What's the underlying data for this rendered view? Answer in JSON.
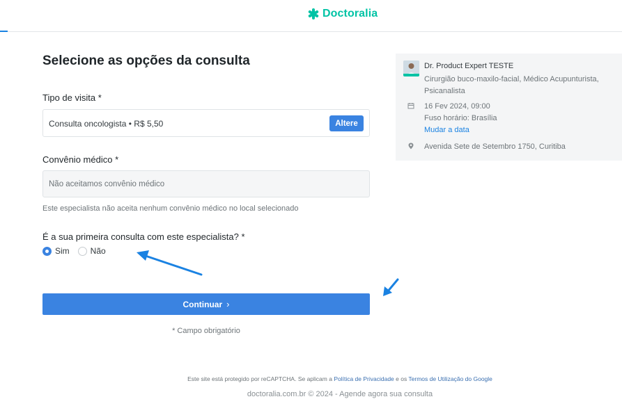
{
  "header": {
    "brand": "Doctoralia",
    "brand_color": "#00c3a5"
  },
  "form": {
    "title": "Selecione as opções da consulta",
    "visit_type": {
      "label": "Tipo de visita",
      "required_mark": "*",
      "value": "Consulta oncologista • R$ 5,50",
      "change_button": "Altere"
    },
    "insurance": {
      "label": "Convênio médico",
      "required_mark": "*",
      "value": "Não aceitamos convênio médico",
      "help": "Este especialista não aceita nenhum convênio médico no local selecionado"
    },
    "first_visit": {
      "question": "É a sua primeira consulta com este especialista?",
      "required_mark": "*",
      "options": [
        {
          "label": "Sim",
          "selected": true
        },
        {
          "label": "Não",
          "selected": false
        }
      ]
    },
    "continue_button": "Continuar",
    "continue_icon": "chevron-right-icon",
    "required_note": "* Campo obrigatório"
  },
  "summary": {
    "doctor_name": "Dr. Product Expert TESTE",
    "specialties": "Cirurgião buco-maxilo-facial, Médico Acupunturista, Psicanalista",
    "date": "16 Fev 2024, 09:00",
    "timezone": "Fuso horário: Brasília",
    "change_date": "Mudar a data",
    "address": "Avenida Sete de Setembro 1750, Curitiba"
  },
  "footer": {
    "recaptcha_prefix": "Este site está protegido por reCAPTCHA. Se aplicam a ",
    "privacy_link": "Política de Privacidade",
    "recaptcha_middle": " e os ",
    "terms_link": "Termos de Utilização do Google",
    "copyright": "doctoralia.com.br © 2024 - Agende agora sua consulta"
  },
  "colors": {
    "primary_button": "#3a83e1",
    "annotation_arrow": "#1a82e2",
    "link": "#1a82e2"
  }
}
